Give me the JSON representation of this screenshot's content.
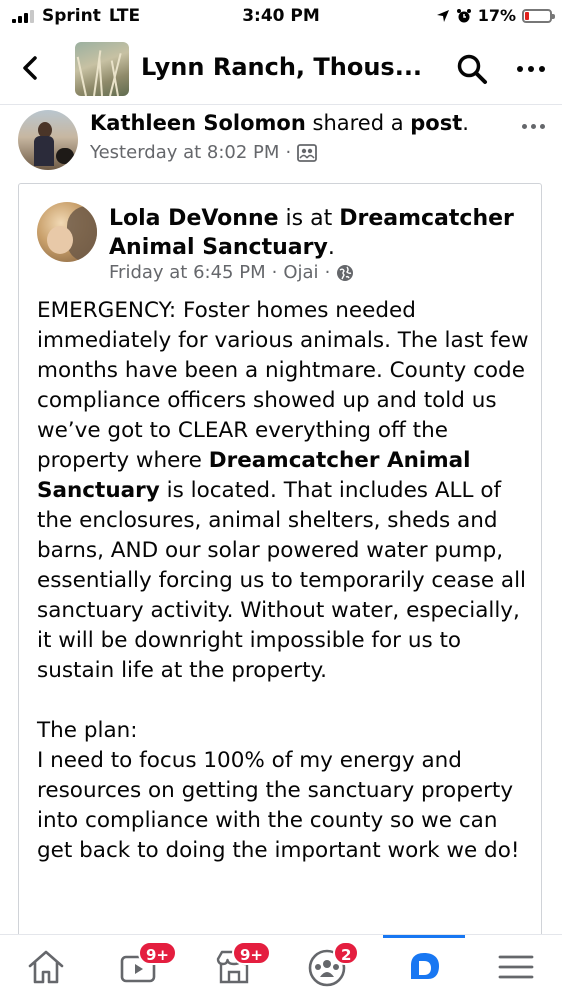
{
  "status_bar": {
    "carrier": "Sprint",
    "network": "LTE",
    "time": "3:40 PM",
    "battery_pct": "17%",
    "battery_level": 0.17
  },
  "header": {
    "title": "Lynn Ranch, Thous..."
  },
  "share": {
    "name": "Kathleen Solomon",
    "verb": " shared a ",
    "object": "post",
    "end": ".",
    "time": "Yesterday at 8:02 PM",
    "sep": "·"
  },
  "post": {
    "author": "Lola DeVonne",
    "is_at": " is at ",
    "place": "Dreamcatcher Animal Sanctuary",
    "place_end": ".",
    "time": "Friday at 6:45 PM",
    "sep1": "·",
    "location": "Ojai",
    "sep2": "·",
    "body_p1_a": "EMERGENCY:  Foster homes needed immediately for various animals. The last few months have been a nightmare. County code compliance officers showed up and told us we’ve got to CLEAR everything off the property where ",
    "body_p1_bold": "Dreamcatcher Animal Sanctuary",
    "body_p1_b": " is located. That includes ALL of the enclosures, animal shelters, sheds and barns, AND our solar powered water pump, essentially forcing us to temporarily cease all sanctuary activity. Without water, especially, it will be downright impossible for us to sustain life at the property.",
    "body_p2": "The plan:",
    "body_p3": "I need to focus 100% of my energy and resources on getting the sanctuary property into compliance with the county so we can get back to doing the important work we do!"
  },
  "bottom_nav": {
    "items": [
      {
        "name": "home",
        "badge": ""
      },
      {
        "name": "watch",
        "badge": "9+"
      },
      {
        "name": "marketplace",
        "badge": "9+"
      },
      {
        "name": "groups",
        "badge": "2"
      },
      {
        "name": "dating",
        "badge": ""
      },
      {
        "name": "menu",
        "badge": ""
      }
    ]
  },
  "colors": {
    "accent": "#1877f2",
    "badge": "#e41e3f",
    "muted": "#65676b"
  }
}
